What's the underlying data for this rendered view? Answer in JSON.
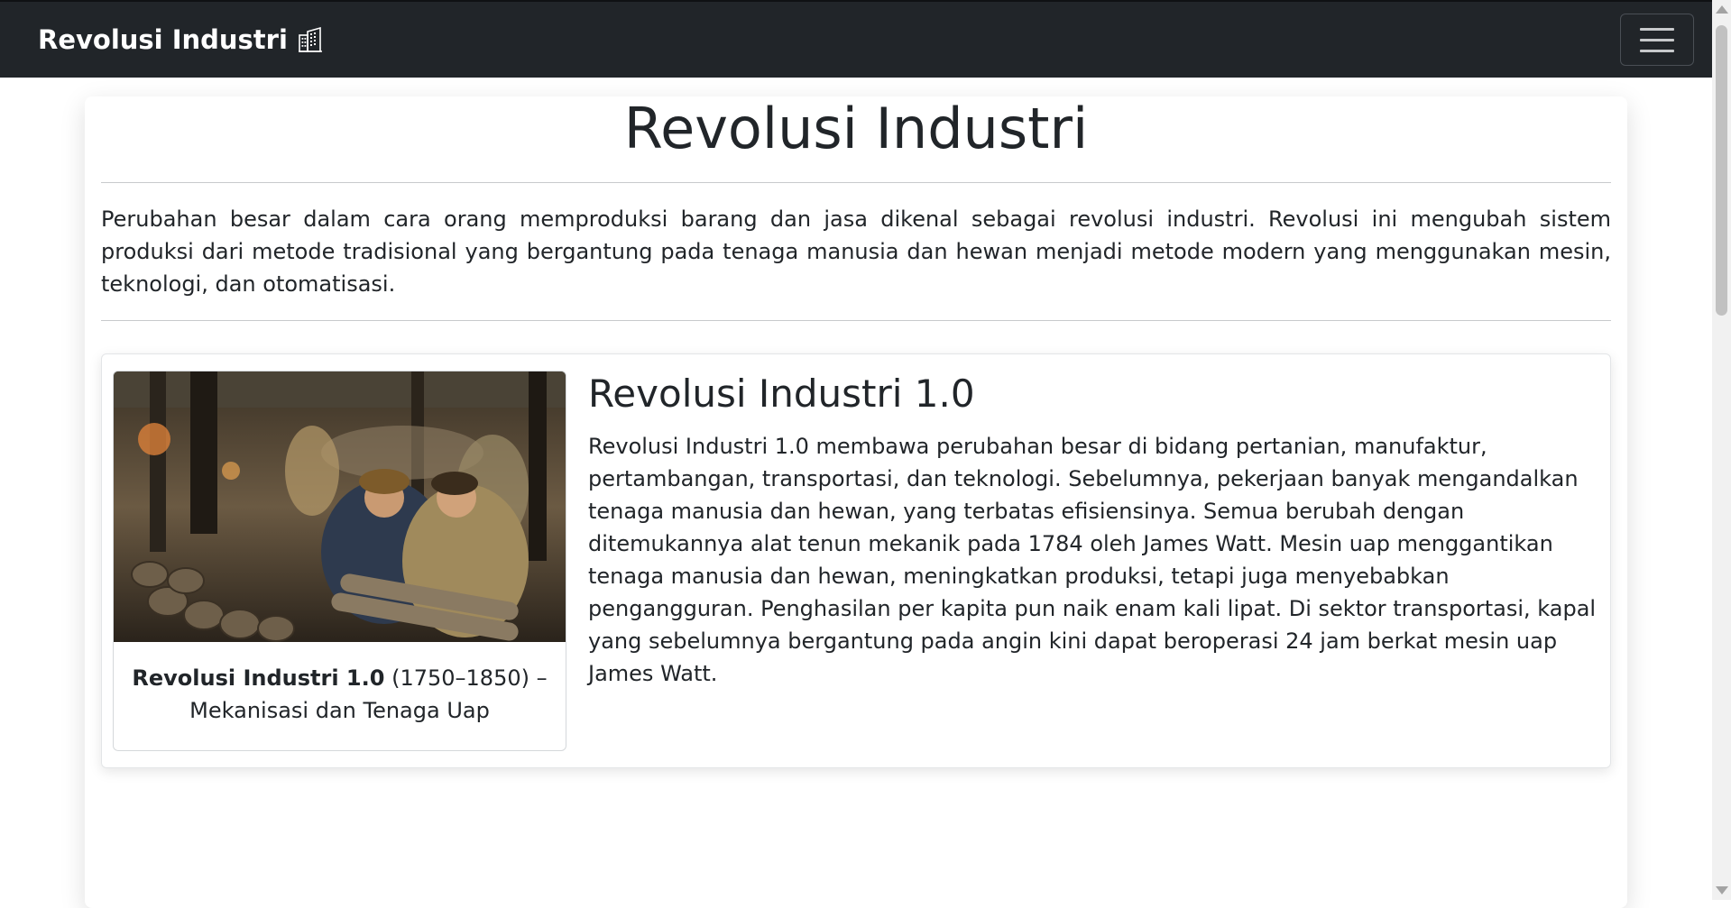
{
  "navbar": {
    "brand": "Revolusi Industri",
    "brand_icon": "buildings-icon",
    "toggler_icon": "hamburger-menu-icon"
  },
  "page": {
    "title": "Revolusi Industri",
    "intro": "Perubahan besar dalam cara orang memproduksi barang dan jasa dikenal sebagai revolusi industri. Revolusi ini mengubah sistem produksi dari metode tradisional yang bergantung pada tenaga manusia dan hewan menjadi metode modern yang menggunakan mesin, teknologi, dan otomatisasi."
  },
  "sections": [
    {
      "title": "Revolusi Industri 1.0",
      "caption_bold": "Revolusi Industri 1.0",
      "caption_rest": " (1750–1850) – Mekanisasi dan Tenaga Uap",
      "image": "painting of women workers in a factory handling metal shells",
      "text": "Revolusi Industri 1.0 membawa perubahan besar di bidang pertanian, manufaktur, pertambangan, transportasi, dan teknologi. Sebelumnya, pekerjaan banyak mengandalkan tenaga manusia dan hewan, yang terbatas efisiensinya. Semua berubah dengan ditemukannya alat tenun mekanik pada 1784 oleh James Watt. Mesin uap menggantikan tenaga manusia dan hewan, meningkatkan produksi, tetapi juga menyebabkan pengangguran. Penghasilan per kapita pun naik enam kali lipat. Di sektor transportasi, kapal yang sebelumnya bergantung pada angin kini dapat beroperasi 24 jam berkat mesin uap James Watt."
    }
  ],
  "colors": {
    "navbar_bg": "#212529",
    "text": "#212529",
    "page_bg": "#ffffff"
  }
}
